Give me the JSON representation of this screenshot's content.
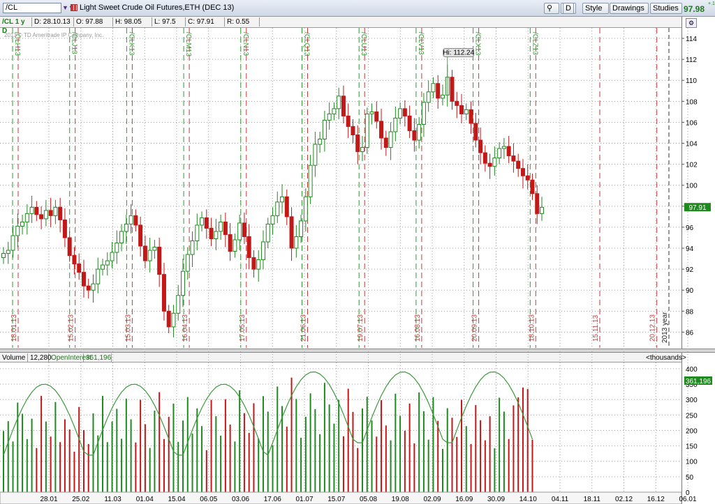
{
  "header": {
    "symbol": "/CL",
    "title": "Light Sweet Crude Oil Futures,ETH (DEC 13)",
    "aggregation": "D",
    "style_label": "Style",
    "drawings_label": "Drawings",
    "studies_label": "Studies",
    "last_price": "97.98",
    "change": "+.1"
  },
  "infobar": {
    "symbol_period": "/CL 1 y D",
    "date": "D: 28.10.13",
    "open": "O: 97.88",
    "high": "H: 98.05",
    "low": "L: 97.5",
    "close": "C: 97.91",
    "range": "R: 0.55"
  },
  "watermark": "2013 © TD Ameritrade IP Company, Inc.",
  "volume_bar": {
    "volume_label": "Volume",
    "volume_value": "12,280",
    "oi_label": "OpenInterest",
    "oi_value": "361,196",
    "units": "<thousands>"
  },
  "colors": {
    "up": "#1f8a1f",
    "down": "#c21818",
    "oi_line": "#3a9a3a",
    "grid": "#a0a0a0",
    "expiry_green": "#2f9a2f",
    "expiry_red": "#c23a3a",
    "price_badge": "#1e8a1e"
  },
  "chart_data": [
    {
      "type": "candlestick",
      "title": "Light Sweet Crude Oil Futures,ETH (DEC 13)",
      "ylim": [
        84.5,
        115
      ],
      "yticks": [
        86,
        88,
        90,
        92,
        94,
        96,
        98,
        100,
        102,
        104,
        106,
        108,
        110,
        112,
        114
      ],
      "high_marker": "Hi: 112.24",
      "last_badge": "97.91",
      "x_labels": [
        "28.01",
        "25.02",
        "11.03",
        "01.04",
        "15.04",
        "06.05",
        "03.06",
        "17.06",
        "01.07",
        "15.07",
        "05.08",
        "19.08",
        "02.09",
        "16.09",
        "30.09",
        "14.10",
        "04.11",
        "18.11",
        "02.12",
        "16.12",
        "06.01"
      ],
      "expiry_labels": [
        {
          "contract": "/CLH13",
          "date": "18.01.13"
        },
        {
          "contract": "/CLJ13",
          "date": "15.02.13"
        },
        {
          "contract": "/CLK13",
          "date": "15.03.13"
        },
        {
          "contract": "/CLM13",
          "date": "16.04.13"
        },
        {
          "contract": "/CLN13",
          "date": "17.05.13"
        },
        {
          "contract": "/CLQ13",
          "date": "21.06.13"
        },
        {
          "contract": "/CLU13",
          "date": "19.07.13"
        },
        {
          "contract": "/CLV13",
          "date": "16.08.13"
        },
        {
          "contract": "/CLX13",
          "date": "20.09.13"
        },
        {
          "contract": "/CLZ13",
          "date": "18.10.13"
        },
        {
          "contract": "",
          "date": "15.11.13"
        },
        {
          "contract": "",
          "date": "20.12.13"
        }
      ],
      "year_label": "2013 year",
      "series_close": [
        93.5,
        93.8,
        95.2,
        96.1,
        96.5,
        97.3,
        97.9,
        97.2,
        96.8,
        97.6,
        97.1,
        97.9,
        96.7,
        95.0,
        93.3,
        92.5,
        91.7,
        90.4,
        90.0,
        90.6,
        92.0,
        92.4,
        92.8,
        93.6,
        94.5,
        95.6,
        96.3,
        97.1,
        96.2,
        94.2,
        92.8,
        93.8,
        94.1,
        91.5,
        88.0,
        86.5,
        87.8,
        89.5,
        91.8,
        93.4,
        94.7,
        96.2,
        96.9,
        95.9,
        94.9,
        95.6,
        96.5,
        95.3,
        93.7,
        94.8,
        96.4,
        95.1,
        93.1,
        92.0,
        92.9,
        94.6,
        96.3,
        97.1,
        98.4,
        98.9,
        97.0,
        94.0,
        95.1,
        96.6,
        98.9,
        101.9,
        103.9,
        104.4,
        106.2,
        106.8,
        107.3,
        108.5,
        106.6,
        105.6,
        104.8,
        103.2,
        103.6,
        106.8,
        107.0,
        106.1,
        104.5,
        103.6,
        105.1,
        106.4,
        107.3,
        106.6,
        105.2,
        104.3,
        105.8,
        107.9,
        108.9,
        109.7,
        108.3,
        108.6,
        110.3,
        108.0,
        107.6,
        106.8,
        107.2,
        105.9,
        104.3,
        103.1,
        102.1,
        101.8,
        102.6,
        103.5,
        103.7,
        102.8,
        102.3,
        101.6,
        100.9,
        100.5,
        99.2,
        97.3,
        97.9
      ],
      "series_volume_k": [
        198,
        230,
        164,
        290,
        254,
        172,
        238,
        143,
        312,
        229,
        180,
        292,
        162,
        236,
        203,
        131,
        276,
        201,
        156,
        255,
        184,
        312,
        162,
        229,
        270,
        173,
        303,
        236,
        161,
        299,
        220,
        143,
        264,
        324,
        172,
        244,
        287,
        163,
        232,
        308,
        190,
        271,
        214,
        136,
        299,
        246,
        183,
        301,
        219,
        164,
        330,
        256,
        192,
        288,
        174,
        311,
        261,
        152,
        342,
        279,
        212,
        371,
        302,
        176,
        244,
        320,
        269,
        188,
        354,
        284,
        222,
        299,
        181,
        335,
        260,
        143,
        271,
        309,
        232,
        180,
        298,
        216,
        168,
        319,
        247,
        199,
        287,
        158,
        323,
        262,
        170,
        308,
        231,
        140,
        272,
        241,
        179,
        299,
        214,
        156,
        282,
        233,
        168,
        246,
        142,
        306,
        261,
        172,
        281,
        307,
        339,
        334,
        170
      ]
    }
  ],
  "volume_axis": {
    "ylim": [
      0,
      420
    ],
    "yticks": [
      0,
      50,
      100,
      150,
      200,
      250,
      300,
      350,
      400
    ],
    "oi_badge": "361,196"
  }
}
